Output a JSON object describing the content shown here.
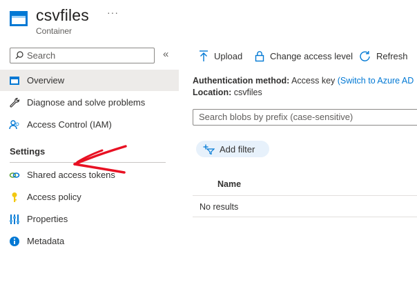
{
  "header": {
    "title": "csvfiles",
    "subtitle": "Container",
    "more_label": "···",
    "icon": "storage-container-icon"
  },
  "sidebar": {
    "search": {
      "placeholder": "Search",
      "icon": "search-icon"
    },
    "collapse_icon": "double-chevron-left-icon",
    "collapse_label": "«",
    "items": [
      {
        "label": "Overview",
        "icon": "overview-icon",
        "active": true
      },
      {
        "label": "Diagnose and solve problems",
        "icon": "wrench-icon"
      },
      {
        "label": "Access Control (IAM)",
        "icon": "people-icon"
      }
    ],
    "section_title": "Settings",
    "settings_items": [
      {
        "label": "Shared access tokens",
        "icon": "link-icon"
      },
      {
        "label": "Access policy",
        "icon": "key-icon"
      },
      {
        "label": "Properties",
        "icon": "properties-icon"
      },
      {
        "label": "Metadata",
        "icon": "info-icon"
      }
    ]
  },
  "toolbar": {
    "upload_label": "Upload",
    "change_access_label": "Change access level",
    "refresh_label": "Refresh"
  },
  "info": {
    "auth_label": "Authentication method:",
    "auth_value": "Access key",
    "auth_link": "(Switch to Azure AD",
    "location_label": "Location:",
    "location_value": "csvfiles"
  },
  "blob_search": {
    "placeholder": "Search blobs by prefix (case-sensitive)"
  },
  "filter": {
    "label": "Add filter"
  },
  "table": {
    "columns": [
      "Name"
    ],
    "empty_text": "No results"
  },
  "colors": {
    "accent": "#0078d4",
    "active_bg": "#edebe9",
    "annotation": "#e81123",
    "filter_pill_bg": "#e7f1fb"
  }
}
